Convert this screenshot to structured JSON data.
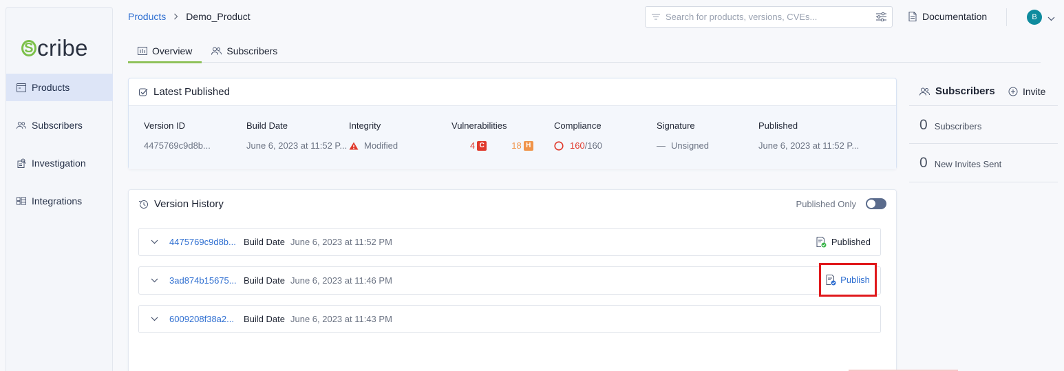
{
  "app": {
    "name": "Scribe"
  },
  "logo": {
    "text": "cribe",
    "mark": "S"
  },
  "sidebar": {
    "items": [
      {
        "label": "Products",
        "icon": "products-icon",
        "active": true
      },
      {
        "label": "Subscribers",
        "icon": "users-icon",
        "active": false
      },
      {
        "label": "Investigation",
        "icon": "investigation-icon",
        "active": false
      },
      {
        "label": "Integrations",
        "icon": "integrations-icon",
        "active": false
      }
    ]
  },
  "breadcrumb": {
    "root": "Products",
    "current": "Demo_Product"
  },
  "search": {
    "placeholder": "Search for products, versions, CVEs...",
    "value": ""
  },
  "header": {
    "documentation": "Documentation",
    "avatar_initial": "B"
  },
  "tabs": [
    {
      "label": "Overview",
      "active": true
    },
    {
      "label": "Subscribers",
      "active": false
    }
  ],
  "latest": {
    "title": "Latest Published",
    "columns": {
      "version_id": {
        "label": "Version ID",
        "value": "4475769c9d8b..."
      },
      "build_date": {
        "label": "Build Date",
        "value": "June 6, 2023 at 11:52 P..."
      },
      "integrity": {
        "label": "Integrity",
        "value": "Modified"
      },
      "vulnerabilities": {
        "label": "Vulnerabilities",
        "critical": "4",
        "critical_badge": "C",
        "high": "18",
        "high_badge": "H"
      },
      "compliance": {
        "label": "Compliance",
        "passed": "160",
        "total": "/160"
      },
      "signature": {
        "label": "Signature",
        "dash": "—",
        "value": "Unsigned"
      },
      "published": {
        "label": "Published",
        "value": "June 6, 2023 at 11:52 P..."
      }
    }
  },
  "history": {
    "title": "Version History",
    "toggle_label": "Published Only",
    "build_date_label": "Build Date",
    "rows": [
      {
        "id": "4475769c9d8b...",
        "date": "June 6, 2023 at 11:52 PM",
        "status": "Published"
      },
      {
        "id": "3ad874b15675...",
        "date": "June 6, 2023 at 11:46 PM",
        "status": "Publish"
      },
      {
        "id": "6009208f38a2...",
        "date": "June 6, 2023 at 11:43 PM",
        "status": ""
      }
    ]
  },
  "subscribers_panel": {
    "title": "Subscribers",
    "invite": "Invite",
    "stats": [
      {
        "num": "0",
        "label": "Subscribers"
      },
      {
        "num": "0",
        "label": "New Invites Sent"
      }
    ]
  },
  "colors": {
    "accent": "#2f6fd1",
    "tab_underline": "#8fc25b",
    "critical": "#e0392c",
    "high": "#f0944a",
    "highlight_box": "#e0191c"
  }
}
